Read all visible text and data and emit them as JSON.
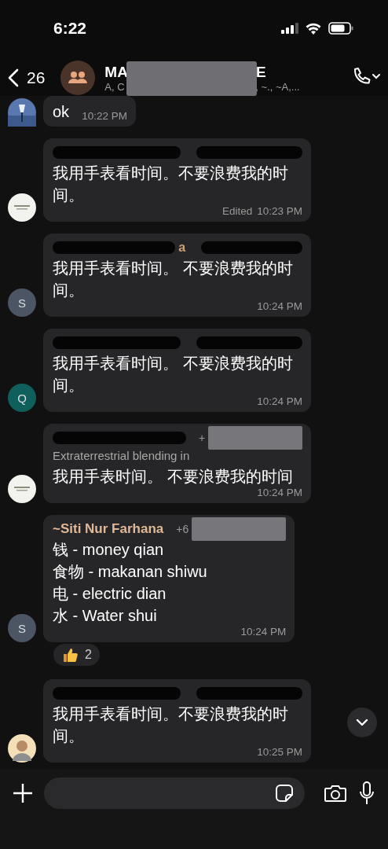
{
  "status_bar": {
    "time": "6:22"
  },
  "header": {
    "back_count": "26",
    "title_start": "MA",
    "title_end": "E",
    "subtitle_start": "A, C",
    "subtitle_end": "., ~., ~A,...",
    "title_hidden": true
  },
  "messages": [
    {
      "sender_hidden": false,
      "lines": [
        "ok"
      ],
      "time": "10:22 PM"
    },
    {
      "sender_hidden": true,
      "lines": [
        "我用手表看时间。不要浪费我的时间。"
      ],
      "edited": "Edited",
      "time": "10:23 PM"
    },
    {
      "avatar": {
        "kind": "letter",
        "letter": "S",
        "color": "#4b5563"
      },
      "sender_hidden": true,
      "sender_tail": {
        "text": "a",
        "color": "#c9a27a"
      },
      "lines": [
        "我用手表看时间。 不要浪费我的时间。"
      ],
      "time": "10:24 PM"
    },
    {
      "avatar": {
        "kind": "letter",
        "letter": "Q",
        "color": "#0f5f5c"
      },
      "sender_hidden": true,
      "lines": [
        "我用手表看时间。 不要浪费我的时间。"
      ],
      "time": "10:24 PM"
    },
    {
      "sender_hidden": true,
      "phone": {
        "prefix": "+",
        "hidden": true
      },
      "about": "Extraterrestrial blending in",
      "lines": [
        "我用手表时间。 不要浪费我的时间"
      ],
      "time": "10:24 PM"
    },
    {
      "avatar": {
        "kind": "letter",
        "letter": "S",
        "color": "#4b5563"
      },
      "sender_hidden": false,
      "sender": {
        "name": "~Siti Nur Farhana",
        "color": "#e0b896"
      },
      "phone": {
        "prefix": "+6",
        "hidden": true
      },
      "lines": [
        "钱 - money qian",
        "食物 - makanan shiwu",
        "电 - electric dian",
        "水 - Water shui"
      ],
      "time": "10:24 PM",
      "reaction": {
        "count": "2"
      }
    },
    {
      "avatar": {
        "kind": "figure"
      },
      "sender_hidden": true,
      "lines": [
        "我用手表看时间。不要浪费我的时间。"
      ],
      "time": "10:25 PM"
    }
  ]
}
